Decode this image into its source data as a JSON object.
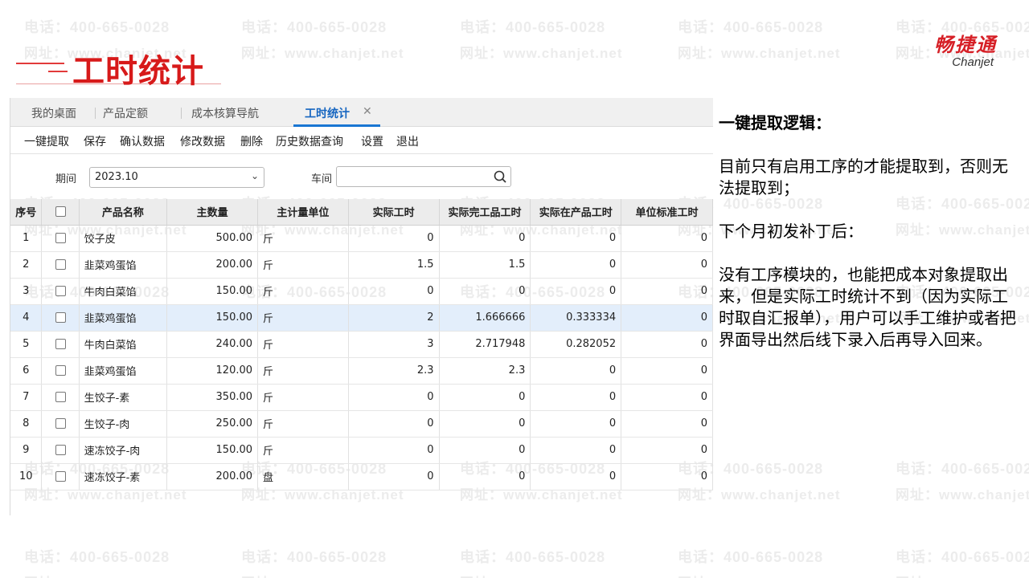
{
  "watermark": {
    "line1": "电话：400-665-0028",
    "line2": "网址：www.chanjet.net"
  },
  "slide": {
    "title": "工时统计"
  },
  "logo": {
    "cn": "畅捷通",
    "en": "Chanjet"
  },
  "tabs": [
    {
      "label": "我的桌面"
    },
    {
      "label": "产品定额"
    },
    {
      "label": "成本核算导航"
    },
    {
      "label": "工时统计",
      "active": true
    }
  ],
  "toolbar": [
    "一键提取",
    "保存",
    "确认数据",
    "修改数据",
    "删除",
    "历史数据查询",
    "设置",
    "退出"
  ],
  "filter": {
    "period_label": "期间",
    "period_value": "2023.10",
    "workshop_label": "车间",
    "workshop_value": ""
  },
  "table": {
    "columns": [
      "序号",
      "产品名称",
      "主数量",
      "主计量单位",
      "实际工时",
      "实际完工品工时",
      "实际在产品工时",
      "单位标准工时"
    ],
    "rows": [
      [
        "1",
        "饺子皮",
        "500.00",
        "斤",
        "0",
        "0",
        "0",
        "0"
      ],
      [
        "2",
        "韭菜鸡蛋馅",
        "200.00",
        "斤",
        "1.5",
        "1.5",
        "0",
        "0"
      ],
      [
        "3",
        "牛肉白菜馅",
        "150.00",
        "斤",
        "0",
        "0",
        "0",
        "0"
      ],
      [
        "4",
        "韭菜鸡蛋馅",
        "150.00",
        "斤",
        "2",
        "1.666666",
        "0.333334",
        "0"
      ],
      [
        "5",
        "牛肉白菜馅",
        "240.00",
        "斤",
        "3",
        "2.717948",
        "0.282052",
        "0"
      ],
      [
        "6",
        "韭菜鸡蛋馅",
        "120.00",
        "斤",
        "2.3",
        "2.3",
        "0",
        "0"
      ],
      [
        "7",
        "生饺子-素",
        "350.00",
        "斤",
        "0",
        "0",
        "0",
        "0"
      ],
      [
        "8",
        "生饺子-肉",
        "250.00",
        "斤",
        "0",
        "0",
        "0",
        "0"
      ],
      [
        "9",
        "速冻饺子-肉",
        "150.00",
        "斤",
        "0",
        "0",
        "0",
        "0"
      ],
      [
        "10",
        "速冻饺子-素",
        "200.00",
        "盘",
        "0",
        "0",
        "0",
        "0"
      ]
    ],
    "highlight_row": 4
  },
  "notes": {
    "heading": "一键提取逻辑：",
    "p1": "目前只有启用工序的才能提取到，否则无法提取到；",
    "p2": "下个月初发补丁后：",
    "p3": "没有工序模块的，也能把成本对象提取出来，但是实际工时统计不到（因为实际工时取自汇报单），用户可以手工维护或者把界面导出然后线下录入后再导入回来。"
  },
  "colors": {
    "title_red": "#d71a1a",
    "tab_active_blue": "#1565c0",
    "row_highlight": "#e3eefb"
  }
}
